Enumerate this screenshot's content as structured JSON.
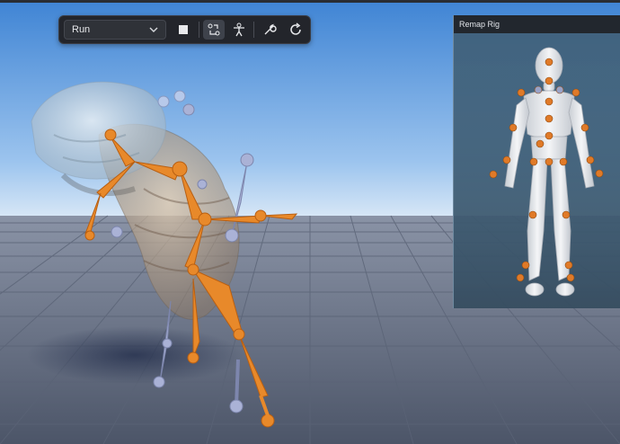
{
  "toolbar": {
    "animation_select": {
      "value": "Run"
    },
    "buttons": [
      {
        "name": "stop-button",
        "icon": "stop-icon"
      },
      {
        "name": "retarget-button",
        "icon": "retarget-arrows-icon",
        "active": true
      },
      {
        "name": "rig-button",
        "icon": "figure-icon"
      },
      {
        "name": "settings-button",
        "icon": "wrench-icon"
      },
      {
        "name": "reset-button",
        "icon": "refresh-icon"
      }
    ]
  },
  "remap_panel": {
    "title": "Remap Rig",
    "joint_colors": {
      "mapped": "#e07a28",
      "unmapped": "#9aa3c8"
    }
  },
  "viewport": {
    "sky_top": "#4a8fd8",
    "sky_horizon": "#c9dff5",
    "floor": "#6b7488",
    "bone_color": "#e8892a",
    "secondary_bone_color": "#aab2d6"
  }
}
